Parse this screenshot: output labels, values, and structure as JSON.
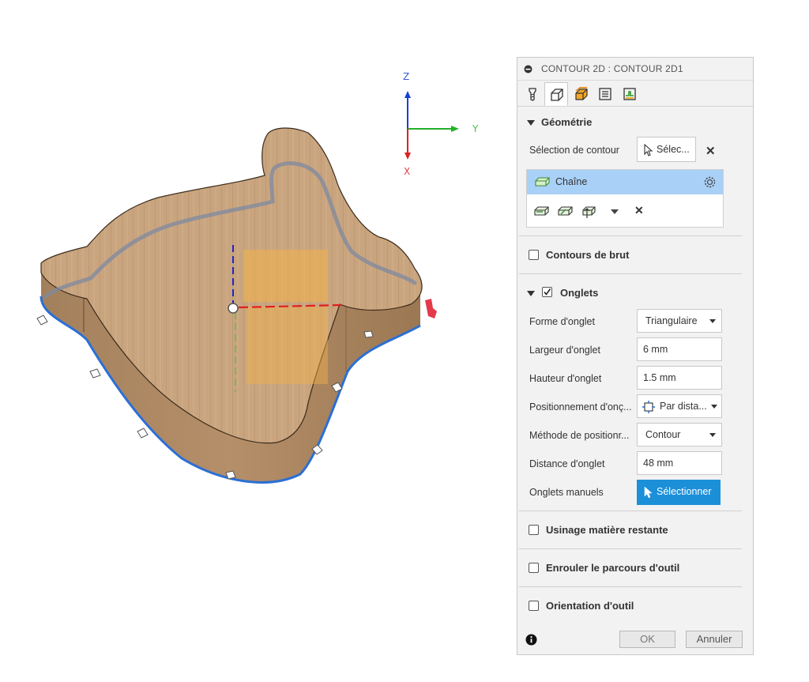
{
  "axes": {
    "z": "Z",
    "y": "Y",
    "x": "X"
  },
  "dialog": {
    "title": "CONTOUR 2D : CONTOUR 2D1",
    "tabs": [
      {
        "name": "tool-tab",
        "icon": "tool-icon"
      },
      {
        "name": "geometry-tab",
        "icon": "geometry-icon",
        "active": true
      },
      {
        "name": "heights-tab",
        "icon": "heights-icon"
      },
      {
        "name": "passes-tab",
        "icon": "passes-icon"
      },
      {
        "name": "linking-tab",
        "icon": "linking-icon"
      }
    ],
    "geometry": {
      "header": "Géométrie",
      "contour_selection_label": "Sélection de contour",
      "select_button": "Sélec...",
      "chain_label": "Chaîne"
    },
    "stock_contours": {
      "label": "Contours de brut",
      "checked": false
    },
    "tabs_section": {
      "header": "Onglets",
      "checked": true,
      "fields": {
        "tab_shape": {
          "label": "Forme d'onglet",
          "value": "Triangulaire"
        },
        "tab_width": {
          "label": "Largeur d'onglet",
          "value": "6 mm"
        },
        "tab_height": {
          "label": "Hauteur d'onglet",
          "value": "1.5 mm"
        },
        "tab_positioning": {
          "label": "Positionnement d'onç...",
          "value": "Par dista..."
        },
        "positioning_method": {
          "label": "Méthode de positionr...",
          "value": "Contour"
        },
        "tab_distance": {
          "label": "Distance d'onglet",
          "value": "48 mm"
        },
        "manual_tabs": {
          "label": "Onglets manuels",
          "button": "Sélectionner"
        }
      }
    },
    "rest_machining": {
      "label": "Usinage matière restante",
      "checked": false
    },
    "wrap_toolpath": {
      "label": "Enrouler le parcours d'outil",
      "checked": false
    },
    "tool_orientation": {
      "label": "Orientation d'outil",
      "checked": false
    },
    "footer": {
      "ok": "OK",
      "cancel": "Annuler"
    }
  },
  "colors": {
    "accent": "#1c8fd9",
    "selection": "#a9d0f6",
    "wood": "#c8a37e",
    "contour": "#2a6fd6"
  }
}
